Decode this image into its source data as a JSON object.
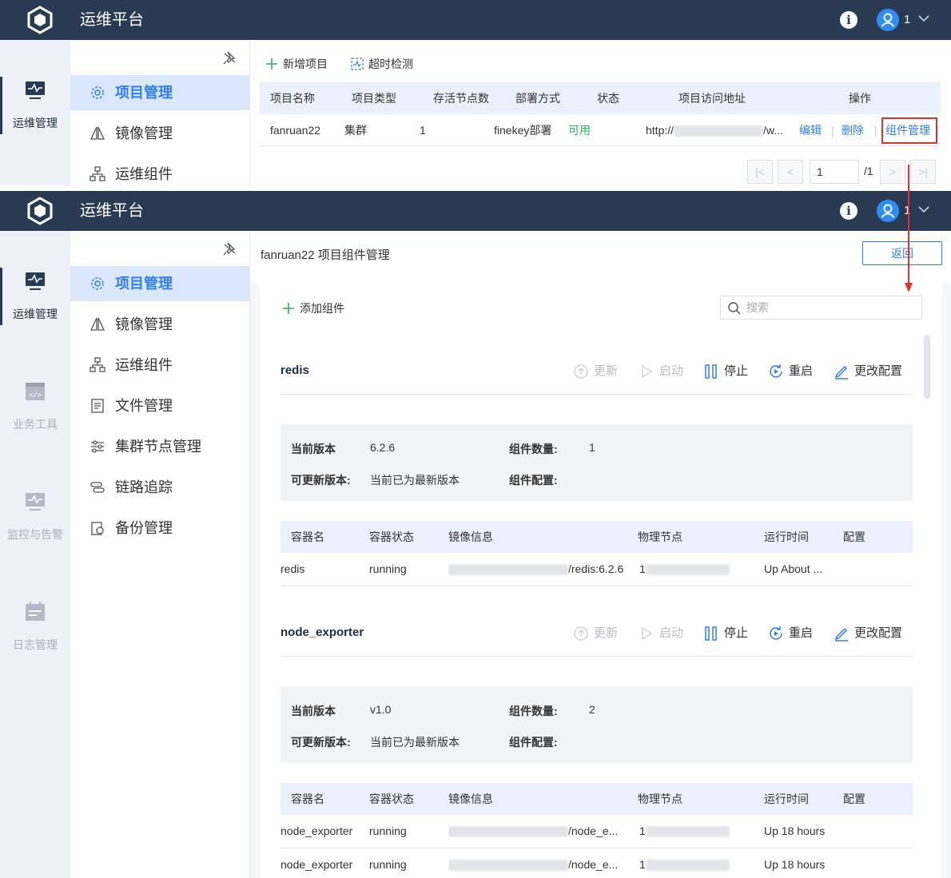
{
  "app": {
    "title": "运维平台",
    "user": "1"
  },
  "rail": [
    {
      "label": "运维管理",
      "icon": "monitor-icon"
    },
    {
      "label": "业务工具",
      "icon": "code-window-icon"
    },
    {
      "label": "监控与告警",
      "icon": "monitor-alert-icon"
    },
    {
      "label": "日志管理",
      "icon": "calendar-log-icon"
    }
  ],
  "menu": [
    {
      "label": "项目管理",
      "icon": "gear-icon"
    },
    {
      "label": "镜像管理",
      "icon": "mirror-icon"
    },
    {
      "label": "运维组件",
      "icon": "org-chart-icon"
    },
    {
      "label": "文件管理",
      "icon": "file-icon"
    },
    {
      "label": "集群节点管理",
      "icon": "sliders-icon"
    },
    {
      "label": "链路追踪",
      "icon": "link-trace-icon"
    },
    {
      "label": "备份管理",
      "icon": "backup-icon"
    }
  ],
  "project_list": {
    "toolbar": {
      "add": "新增项目",
      "timeout": "超时检测"
    },
    "columns": [
      "项目名称",
      "项目类型",
      "存活节点数",
      "部署方式",
      "状态",
      "项目访问地址",
      "操作"
    ],
    "row": {
      "name": "fanruan22",
      "type": "集群",
      "alive": "1",
      "deploy": "finekey部署",
      "status": "可用",
      "url_prefix": "http://",
      "url_suffix": "/w...",
      "actions": {
        "edit": "编辑",
        "delete": "删除",
        "components": "组件管理"
      },
      "sep": "|"
    },
    "pager": {
      "page": "1",
      "total": "/1"
    }
  },
  "component_page": {
    "title": "fanruan22 项目组件管理",
    "back": "返回",
    "add": "添加组件",
    "search_placeholder": "搜索",
    "actions": {
      "update": "更新",
      "start": "启动",
      "stop": "停止",
      "restart": "重启",
      "config": "更改配置"
    },
    "labels": {
      "current_version": "当前版本",
      "count": "组件数量:",
      "updatable": "可更新版本:",
      "config": "组件配置:"
    },
    "columns": [
      "容器名",
      "容器状态",
      "镜像信息",
      "物理节点",
      "运行时间",
      "配置"
    ],
    "components": [
      {
        "name": "redis",
        "version": "6.2.6",
        "count": "1",
        "updatable": "当前已为最新版本",
        "rows": [
          {
            "container": "redis",
            "state": "running",
            "image": "/redis:6.2.6",
            "node": "1",
            "uptime": "Up About ..."
          }
        ]
      },
      {
        "name": "node_exporter",
        "version": "v1.0",
        "count": "2",
        "updatable": "当前已为最新版本",
        "rows": [
          {
            "container": "node_exporter",
            "state": "running",
            "image": "/node_e...",
            "node": "1",
            "uptime": "Up 18 hours"
          },
          {
            "container": "node_exporter",
            "state": "running",
            "image": "/node_e...",
            "node": "1",
            "uptime": "Up 18 hours"
          }
        ]
      }
    ]
  },
  "colors": {
    "topbar": "#2a3a52",
    "accent": "#2f7ef5",
    "ok": "#2db35d",
    "highlight": "#e03131"
  }
}
